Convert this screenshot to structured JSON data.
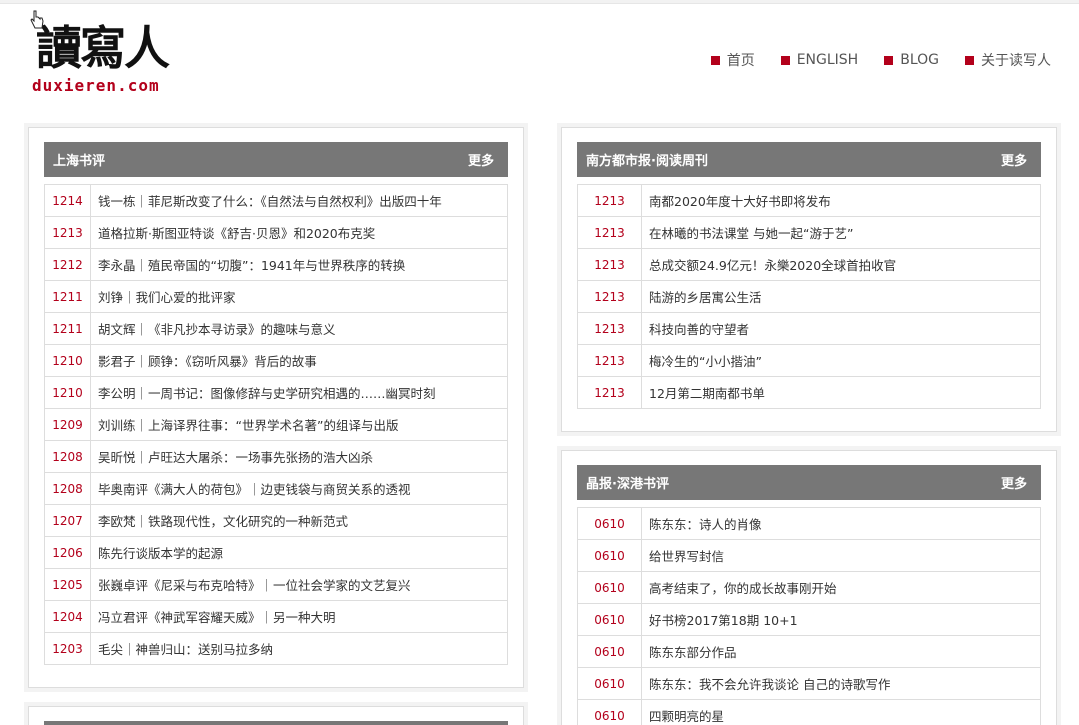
{
  "site": {
    "logo_text": "讀寫人",
    "logo_domain": "duxieren.com"
  },
  "nav": [
    {
      "label": "首页"
    },
    {
      "label": "ENGLISH"
    },
    {
      "label": "BLOG"
    },
    {
      "label": "关于读写人"
    }
  ],
  "accent_color": "#b3001b",
  "left_panel": {
    "title": "上海书评",
    "more": "更多",
    "items": [
      {
        "date": "1214",
        "title": "钱一栋｜菲尼斯改变了什么：《自然法与自然权利》出版四十年"
      },
      {
        "date": "1213",
        "title": "道格拉斯·斯图亚特谈《舒吉·贝恩》和2020布克奖"
      },
      {
        "date": "1212",
        "title": "李永晶｜殖民帝国的“切腹”：1941年与世界秩序的转换"
      },
      {
        "date": "1211",
        "title": "刘铮｜我们心爱的批评家"
      },
      {
        "date": "1211",
        "title": "胡文辉｜《非凡抄本寻访录》的趣味与意义"
      },
      {
        "date": "1210",
        "title": "影君子｜顾铮：《窃听风暴》背后的故事"
      },
      {
        "date": "1210",
        "title": "李公明｜一周书记：图像修辞与史学研究相遇的……幽冥时刻"
      },
      {
        "date": "1209",
        "title": "刘训练｜上海译界往事：“世界学术名著”的组译与出版"
      },
      {
        "date": "1208",
        "title": "吴昕悦｜卢旺达大屠杀：一场事先张扬的浩大凶杀"
      },
      {
        "date": "1208",
        "title": "毕奥南评《满大人的荷包》｜边吏钱袋与商贸关系的透视"
      },
      {
        "date": "1207",
        "title": "李欧梵｜铁路现代性，文化研究的一种新范式"
      },
      {
        "date": "1206",
        "title": "陈先行谈版本学的起源"
      },
      {
        "date": "1205",
        "title": "张巍卓评《尼采与布克哈特》｜一位社会学家的文艺复兴"
      },
      {
        "date": "1204",
        "title": "冯立君评《神武军容耀天威》｜另一种大明"
      },
      {
        "date": "1203",
        "title": "毛尖｜神兽归山：送别马拉多纳"
      }
    ]
  },
  "right_panel_1": {
    "title": "南方都市报·阅读周刊",
    "more": "更多",
    "items": [
      {
        "date": "1213",
        "title": "南都2020年度十大好书即将发布"
      },
      {
        "date": "1213",
        "title": "在林曦的书法课堂 与她一起“游于艺”"
      },
      {
        "date": "1213",
        "title": "总成交额24.9亿元！永樂2020全球首拍收官"
      },
      {
        "date": "1213",
        "title": "陆游的乡居寓公生活"
      },
      {
        "date": "1213",
        "title": "科技向善的守望者"
      },
      {
        "date": "1213",
        "title": "梅冷生的“小小揩油”"
      },
      {
        "date": "1213",
        "title": "12月第二期南都书单"
      }
    ]
  },
  "right_panel_2": {
    "title": "晶报·深港书评",
    "more": "更多",
    "items": [
      {
        "date": "0610",
        "title": "陈东东：诗人的肖像"
      },
      {
        "date": "0610",
        "title": "给世界写封信"
      },
      {
        "date": "0610",
        "title": "高考结束了，你的成长故事刚开始"
      },
      {
        "date": "0610",
        "title": "好书榜2017第18期 10+1"
      },
      {
        "date": "0610",
        "title": "陈东东部分作品"
      },
      {
        "date": "0610",
        "title": "陈东东：我不会允许我谈论 自己的诗歌写作"
      },
      {
        "date": "0610",
        "title": "四颗明亮的星"
      }
    ]
  }
}
